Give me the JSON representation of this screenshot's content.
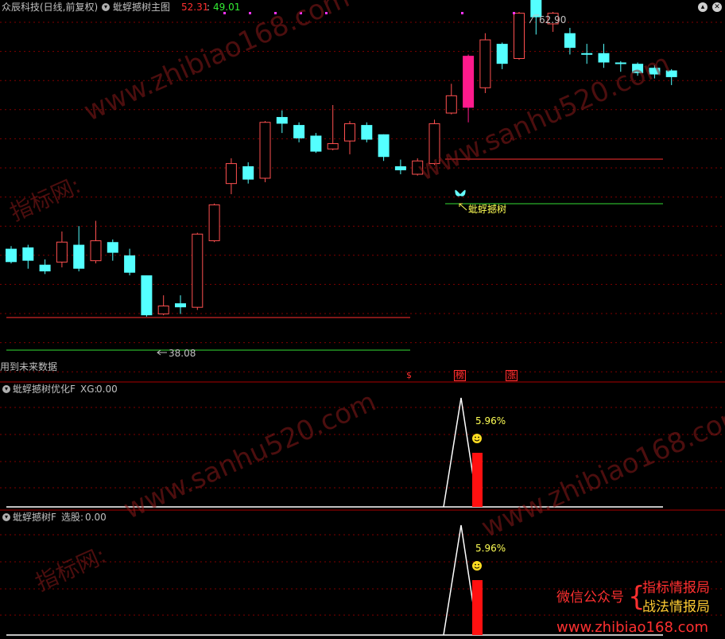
{
  "colors": {
    "up": "#ff5050",
    "down": "#54ffff",
    "big_up": "#ff1a8c",
    "red_line": "#ff3030",
    "green_line": "#33dd33",
    "grid": "#800000",
    "white": "#ffffff",
    "yellow": "#ffff55",
    "bar": "#ff1010",
    "watermark": "#a01818"
  },
  "main": {
    "stock": "众辰科技(日线,前复权)",
    "indicator": "蚍蜉撼树主图",
    "v1": "52.31",
    "v2": "49.01",
    "future_note": "用到未来数据",
    "high_label": "62.90",
    "low_label": "38.08",
    "signal_label": "蚍蜉撼树",
    "flags": [
      {
        "text": "$",
        "color": "#ff3030"
      },
      {
        "text": "榜",
        "color": "#ff3030"
      },
      {
        "text": "涨",
        "color": "#ff3030"
      }
    ],
    "candles": [
      {
        "o": 45.7,
        "c": 44.7,
        "h": 45.9,
        "l": 44.6
      },
      {
        "o": 45.8,
        "c": 44.8,
        "h": 46.0,
        "l": 44.2
      },
      {
        "o": 44.5,
        "c": 44.0,
        "h": 44.9,
        "l": 43.8
      },
      {
        "o": 44.7,
        "c": 46.2,
        "h": 47.0,
        "l": 44.3
      },
      {
        "o": 46.0,
        "c": 44.2,
        "h": 47.4,
        "l": 44.0
      },
      {
        "o": 44.8,
        "c": 46.3,
        "h": 47.8,
        "l": 44.6
      },
      {
        "o": 46.2,
        "c": 45.4,
        "h": 46.4,
        "l": 44.8
      },
      {
        "o": 45.2,
        "c": 43.9,
        "h": 45.7,
        "l": 43.7
      },
      {
        "o": 43.7,
        "c": 40.7,
        "h": 43.7,
        "l": 40.6
      },
      {
        "o": 40.8,
        "c": 41.4,
        "h": 42.2,
        "l": 40.7
      },
      {
        "o": 41.6,
        "c": 41.3,
        "h": 42.2,
        "l": 40.8
      },
      {
        "o": 41.3,
        "c": 46.8,
        "h": 46.9,
        "l": 41.1
      },
      {
        "o": 46.3,
        "c": 49.0,
        "h": 49.1,
        "l": 46.2
      },
      {
        "o": 50.6,
        "c": 52.1,
        "h": 52.5,
        "l": 49.8
      },
      {
        "o": 51.9,
        "c": 50.9,
        "h": 52.2,
        "l": 50.6
      },
      {
        "o": 51.0,
        "c": 55.2,
        "h": 55.3,
        "l": 50.7
      },
      {
        "o": 55.6,
        "c": 55.1,
        "h": 56.1,
        "l": 54.4
      },
      {
        "o": 55.0,
        "c": 54.0,
        "h": 55.2,
        "l": 53.7
      },
      {
        "o": 54.2,
        "c": 53.0,
        "h": 54.4,
        "l": 52.9
      },
      {
        "o": 53.2,
        "c": 53.6,
        "h": 56.5,
        "l": 53.1
      },
      {
        "o": 53.8,
        "c": 55.1,
        "h": 55.3,
        "l": 52.8
      },
      {
        "o": 55.0,
        "c": 53.9,
        "h": 55.2,
        "l": 53.7
      },
      {
        "o": 54.3,
        "c": 52.6,
        "h": 54.3,
        "l": 52.3
      },
      {
        "o": 51.9,
        "c": 51.6,
        "h": 52.4,
        "l": 51.3
      },
      {
        "o": 51.3,
        "c": 52.3,
        "h": 52.5,
        "l": 51.2
      },
      {
        "o": 52.1,
        "c": 55.1,
        "h": 55.4,
        "l": 52.0
      },
      {
        "o": 55.9,
        "c": 57.2,
        "h": 58.1,
        "l": 55.8
      },
      {
        "o": 56.3,
        "c": 60.2,
        "h": 60.3,
        "l": 55.2
      },
      {
        "o": 57.8,
        "c": 61.4,
        "h": 61.9,
        "l": 57.4
      },
      {
        "o": 61.1,
        "c": 59.6,
        "h": 61.2,
        "l": 59.2
      },
      {
        "o": 60.0,
        "c": 63.4,
        "h": 63.5,
        "l": 59.9
      },
      {
        "o": 64.7,
        "c": 63.1,
        "h": 64.8,
        "l": 61.8
      },
      {
        "o": 62.6,
        "c": 63.4,
        "h": 63.5,
        "l": 62.0
      },
      {
        "o": 61.9,
        "c": 60.8,
        "h": 62.3,
        "l": 60.3
      },
      {
        "o": 60.4,
        "c": 60.3,
        "h": 61.1,
        "l": 59.6
      },
      {
        "o": 60.4,
        "c": 59.7,
        "h": 61.1,
        "l": 59.3
      },
      {
        "o": 59.7,
        "c": 59.6,
        "h": 59.8,
        "l": 59.0
      },
      {
        "o": 59.6,
        "c": 58.9,
        "h": 59.7,
        "l": 58.7
      },
      {
        "o": 59.3,
        "c": 58.8,
        "h": 59.5,
        "l": 58.5
      },
      {
        "o": 59.1,
        "c": 58.6,
        "h": 59.2,
        "l": 58.0
      }
    ]
  },
  "panel1": {
    "title": "蚍蜉撼树优化F",
    "key": "XG:",
    "value": "0.00",
    "pct": "5.96%"
  },
  "panel2": {
    "title": "蚍蜉撼树F",
    "key": "选股:",
    "value": "0.00",
    "pct": "5.96%"
  },
  "watermarks": [
    "www.zhibiao168.com",
    "www.sanhu520.com",
    "指标网:",
    "www.sanhu520.com",
    "www.zhibiao168.com",
    "指标网:"
  ],
  "footer": {
    "left": "微信公众号",
    "right1": "指标情报局",
    "right2": "战法情报局",
    "url": "www.zhibiao168.com"
  }
}
